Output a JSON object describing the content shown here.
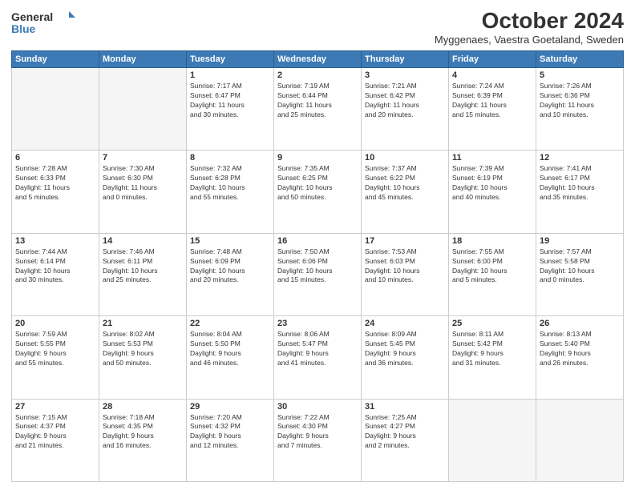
{
  "logo": {
    "line1": "General",
    "line2": "Blue"
  },
  "title": "October 2024",
  "subtitle": "Myggenaes, Vaestra Goetaland, Sweden",
  "days_header": [
    "Sunday",
    "Monday",
    "Tuesday",
    "Wednesday",
    "Thursday",
    "Friday",
    "Saturday"
  ],
  "weeks": [
    [
      {
        "num": "",
        "detail": ""
      },
      {
        "num": "",
        "detail": ""
      },
      {
        "num": "1",
        "detail": "Sunrise: 7:17 AM\nSunset: 6:47 PM\nDaylight: 11 hours\nand 30 minutes."
      },
      {
        "num": "2",
        "detail": "Sunrise: 7:19 AM\nSunset: 6:44 PM\nDaylight: 11 hours\nand 25 minutes."
      },
      {
        "num": "3",
        "detail": "Sunrise: 7:21 AM\nSunset: 6:42 PM\nDaylight: 11 hours\nand 20 minutes."
      },
      {
        "num": "4",
        "detail": "Sunrise: 7:24 AM\nSunset: 6:39 PM\nDaylight: 11 hours\nand 15 minutes."
      },
      {
        "num": "5",
        "detail": "Sunrise: 7:26 AM\nSunset: 6:36 PM\nDaylight: 11 hours\nand 10 minutes."
      }
    ],
    [
      {
        "num": "6",
        "detail": "Sunrise: 7:28 AM\nSunset: 6:33 PM\nDaylight: 11 hours\nand 5 minutes."
      },
      {
        "num": "7",
        "detail": "Sunrise: 7:30 AM\nSunset: 6:30 PM\nDaylight: 11 hours\nand 0 minutes."
      },
      {
        "num": "8",
        "detail": "Sunrise: 7:32 AM\nSunset: 6:28 PM\nDaylight: 10 hours\nand 55 minutes."
      },
      {
        "num": "9",
        "detail": "Sunrise: 7:35 AM\nSunset: 6:25 PM\nDaylight: 10 hours\nand 50 minutes."
      },
      {
        "num": "10",
        "detail": "Sunrise: 7:37 AM\nSunset: 6:22 PM\nDaylight: 10 hours\nand 45 minutes."
      },
      {
        "num": "11",
        "detail": "Sunrise: 7:39 AM\nSunset: 6:19 PM\nDaylight: 10 hours\nand 40 minutes."
      },
      {
        "num": "12",
        "detail": "Sunrise: 7:41 AM\nSunset: 6:17 PM\nDaylight: 10 hours\nand 35 minutes."
      }
    ],
    [
      {
        "num": "13",
        "detail": "Sunrise: 7:44 AM\nSunset: 6:14 PM\nDaylight: 10 hours\nand 30 minutes."
      },
      {
        "num": "14",
        "detail": "Sunrise: 7:46 AM\nSunset: 6:11 PM\nDaylight: 10 hours\nand 25 minutes."
      },
      {
        "num": "15",
        "detail": "Sunrise: 7:48 AM\nSunset: 6:09 PM\nDaylight: 10 hours\nand 20 minutes."
      },
      {
        "num": "16",
        "detail": "Sunrise: 7:50 AM\nSunset: 6:06 PM\nDaylight: 10 hours\nand 15 minutes."
      },
      {
        "num": "17",
        "detail": "Sunrise: 7:53 AM\nSunset: 6:03 PM\nDaylight: 10 hours\nand 10 minutes."
      },
      {
        "num": "18",
        "detail": "Sunrise: 7:55 AM\nSunset: 6:00 PM\nDaylight: 10 hours\nand 5 minutes."
      },
      {
        "num": "19",
        "detail": "Sunrise: 7:57 AM\nSunset: 5:58 PM\nDaylight: 10 hours\nand 0 minutes."
      }
    ],
    [
      {
        "num": "20",
        "detail": "Sunrise: 7:59 AM\nSunset: 5:55 PM\nDaylight: 9 hours\nand 55 minutes."
      },
      {
        "num": "21",
        "detail": "Sunrise: 8:02 AM\nSunset: 5:53 PM\nDaylight: 9 hours\nand 50 minutes."
      },
      {
        "num": "22",
        "detail": "Sunrise: 8:04 AM\nSunset: 5:50 PM\nDaylight: 9 hours\nand 46 minutes."
      },
      {
        "num": "23",
        "detail": "Sunrise: 8:06 AM\nSunset: 5:47 PM\nDaylight: 9 hours\nand 41 minutes."
      },
      {
        "num": "24",
        "detail": "Sunrise: 8:09 AM\nSunset: 5:45 PM\nDaylight: 9 hours\nand 36 minutes."
      },
      {
        "num": "25",
        "detail": "Sunrise: 8:11 AM\nSunset: 5:42 PM\nDaylight: 9 hours\nand 31 minutes."
      },
      {
        "num": "26",
        "detail": "Sunrise: 8:13 AM\nSunset: 5:40 PM\nDaylight: 9 hours\nand 26 minutes."
      }
    ],
    [
      {
        "num": "27",
        "detail": "Sunrise: 7:15 AM\nSunset: 4:37 PM\nDaylight: 9 hours\nand 21 minutes."
      },
      {
        "num": "28",
        "detail": "Sunrise: 7:18 AM\nSunset: 4:35 PM\nDaylight: 9 hours\nand 16 minutes."
      },
      {
        "num": "29",
        "detail": "Sunrise: 7:20 AM\nSunset: 4:32 PM\nDaylight: 9 hours\nand 12 minutes."
      },
      {
        "num": "30",
        "detail": "Sunrise: 7:22 AM\nSunset: 4:30 PM\nDaylight: 9 hours\nand 7 minutes."
      },
      {
        "num": "31",
        "detail": "Sunrise: 7:25 AM\nSunset: 4:27 PM\nDaylight: 9 hours\nand 2 minutes."
      },
      {
        "num": "",
        "detail": ""
      },
      {
        "num": "",
        "detail": ""
      }
    ]
  ]
}
